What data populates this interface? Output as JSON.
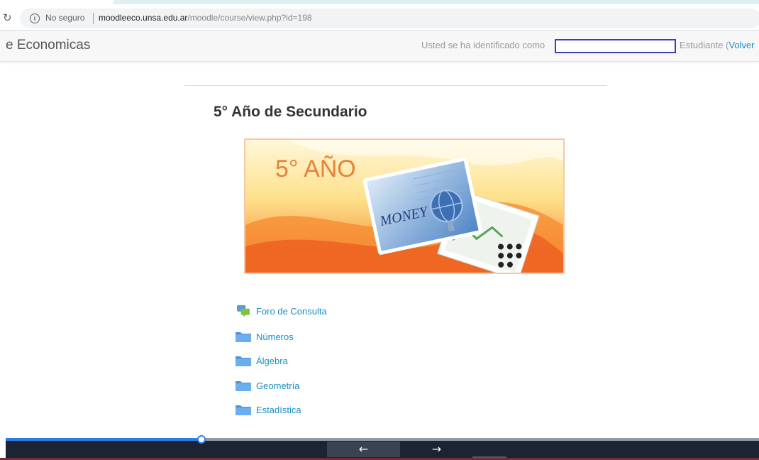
{
  "browser": {
    "security_label": "No seguro",
    "url_host": "moodleeco.unsa.edu.ar",
    "url_path": "/moodle/course/view.php?id=198"
  },
  "navbar": {
    "brand": "e Economicas",
    "login_text": "Usted se ha identificado como",
    "role_text": "Estudiante (",
    "return_link": "Volver"
  },
  "course": {
    "title": "5° Año de Secundario",
    "banner_text": "5° AÑO",
    "banner_money": "MONEY"
  },
  "activities": [
    {
      "label": "Foro de Consulta",
      "icon": "forum-icon"
    },
    {
      "label": "Números",
      "icon": "folder-icon"
    },
    {
      "label": "Álgebra",
      "icon": "folder-icon"
    },
    {
      "label": "Geometría",
      "icon": "folder-icon"
    },
    {
      "label": "Estadística",
      "icon": "folder-icon"
    }
  ],
  "player": {
    "progress": 0.26,
    "prev_icon": "←",
    "next_icon": "→"
  },
  "colors": {
    "link": "#1a8ec4",
    "progress": "#2d7fe2",
    "user_box_border": "#3b3fb5"
  }
}
